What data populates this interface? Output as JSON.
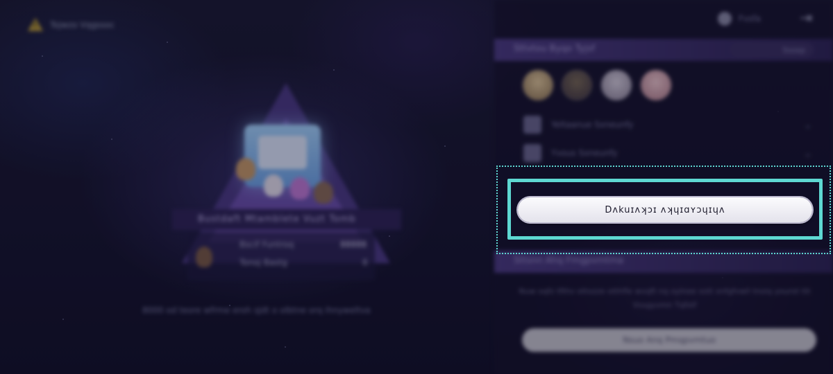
{
  "left": {
    "warning_text": "Tojwzo Vqgssoc",
    "pyramid_title": "Bustdaft Mtamblete Vuzt Tomb",
    "stats": [
      {
        "label": "Bscif Funtroq",
        "value": "88888"
      },
      {
        "label": "Tonoj Bastg",
        "value": "8"
      }
    ],
    "footer_text": "8000 od teore wfrme eroh sJdt o olbtne orq ihnyweltva"
  },
  "panel": {
    "top_label": "Fvsfa",
    "section_title": "Sttvtou Byqo Tyjsf",
    "section_pill": "Ssoxp",
    "perks": [
      {
        "label": "Yeltaanue Sxneunfy"
      },
      {
        "label": "Yvous Sxneunfy"
      }
    ],
    "main_button": "Dʌkuɪʌʞɔɪ ʌʞɥɪɑʏɔɥɪɥʌ",
    "section2_title": "Sttsnn Ahq Fmgpvmtma",
    "description": "Nuw oqfz tfthv ottozze otthfle wvqft nq oylnee xstt xnfgfvwll tnoiq yourot ttt Vssgyvmn Tqfstf",
    "bottom_button": "Nsuo Anq Pmqpvmtuo"
  }
}
